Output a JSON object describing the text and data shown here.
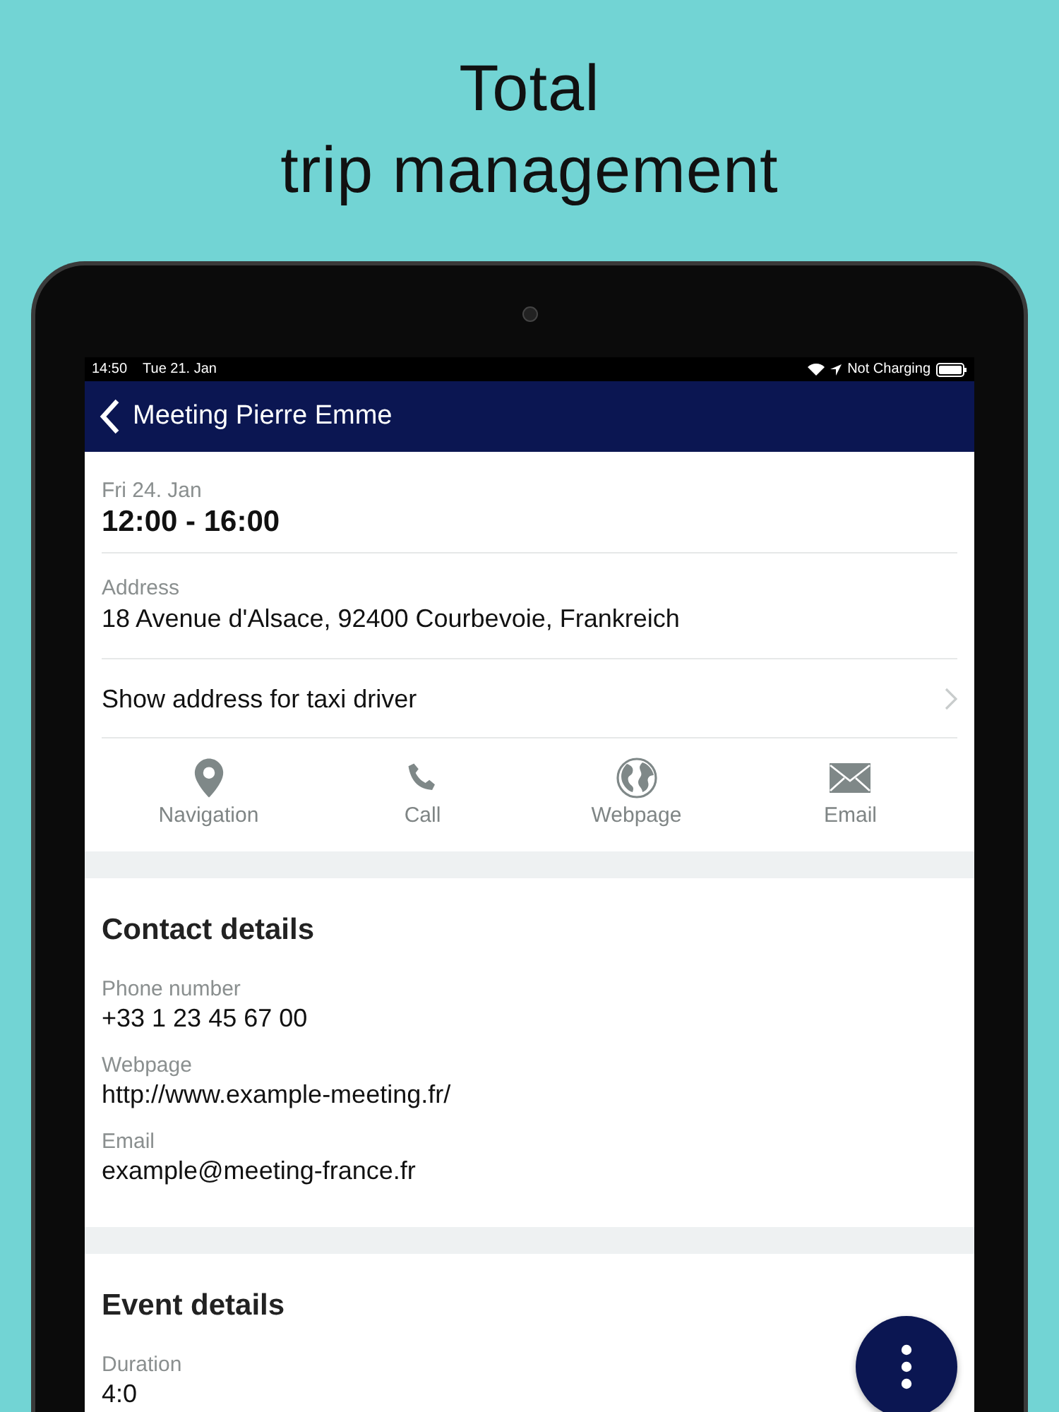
{
  "headline": [
    "Total",
    "trip management"
  ],
  "status_bar": {
    "time": "14:50",
    "date": "Tue 21. Jan",
    "charging": "Not Charging"
  },
  "nav_bar": {
    "title": "Meeting Pierre Emme"
  },
  "appointment": {
    "date": "Fri 24. Jan",
    "time": "12:00 - 16:00",
    "address_label": "Address",
    "address": "18 Avenue d'Alsace, 92400 Courbevoie, Frankreich",
    "taxi_link": "Show address for taxi driver",
    "actions": [
      {
        "kind": "navigation",
        "label": "Navigation"
      },
      {
        "kind": "call",
        "label": "Call"
      },
      {
        "kind": "webpage",
        "label": "Webpage"
      },
      {
        "kind": "email",
        "label": "Email"
      }
    ]
  },
  "sections": [
    {
      "title": "Contact details",
      "fields": [
        {
          "label": "Phone number",
          "value": "+33 1 23 45 67 00"
        },
        {
          "label": "Webpage",
          "value": "http://www.example-meeting.fr/"
        },
        {
          "label": "Email",
          "value": "example@meeting-france.fr"
        }
      ]
    },
    {
      "title": "Event details",
      "fields": [
        {
          "label": "Duration",
          "value": "4:0"
        }
      ]
    }
  ]
}
